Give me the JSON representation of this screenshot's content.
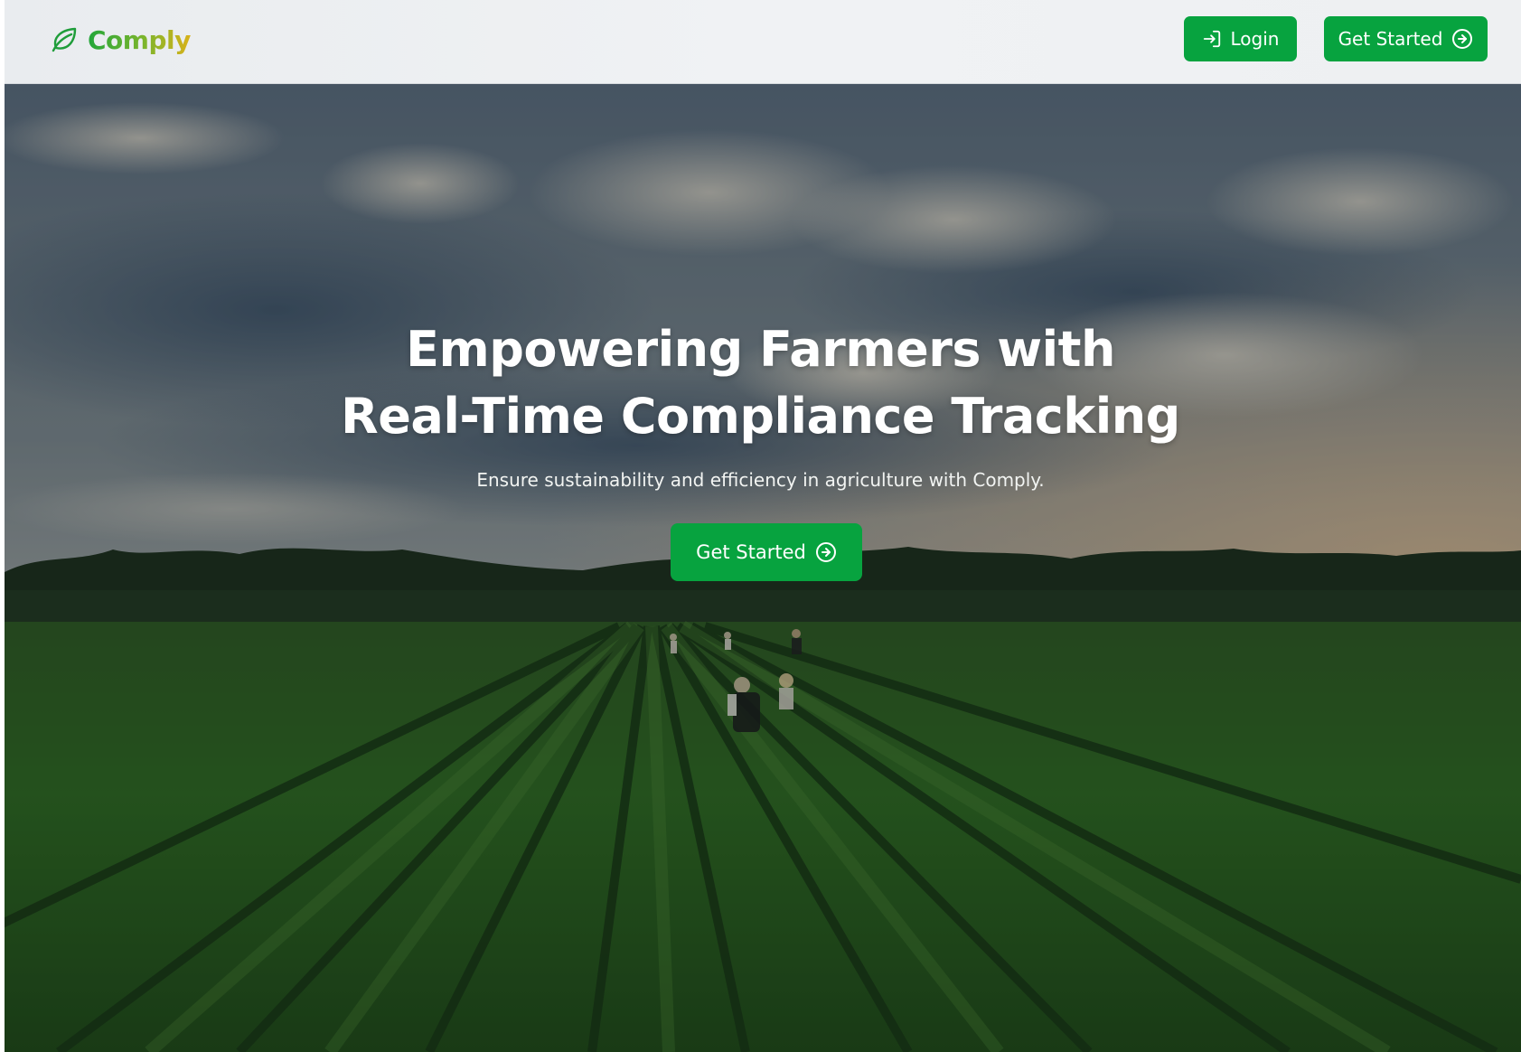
{
  "header": {
    "brand_name": "Comply",
    "brand_icon": "leaf-icon",
    "login_label": "Login",
    "login_icon": "login-arrow-icon",
    "get_started_label": "Get Started",
    "get_started_icon": "circle-arrow-right-icon"
  },
  "hero": {
    "title_line1": "Empowering Farmers with",
    "title_line2": "Real-Time Compliance Tracking",
    "subtitle": "Ensure sustainability and efficiency in agriculture with Comply.",
    "cta_label": "Get Started",
    "cta_icon": "circle-arrow-right-icon",
    "background": "farm-field-photo"
  },
  "colors": {
    "accent": "#07a33f",
    "brand_gradient_start": "#22a63a",
    "brand_gradient_end": "#d9b21a",
    "header_bg": "#eceff1"
  }
}
